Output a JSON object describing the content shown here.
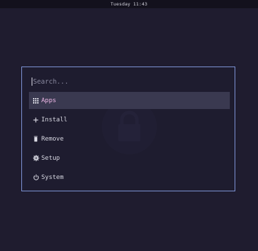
{
  "topbar": {
    "clock": "Tuesday 11:43"
  },
  "launcher": {
    "search": {
      "placeholder": "Search...",
      "value": ""
    },
    "items": [
      {
        "label": "Apps",
        "icon": "grid-icon",
        "selected": true
      },
      {
        "label": "Install",
        "icon": "plus-icon",
        "selected": false
      },
      {
        "label": "Remove",
        "icon": "trash-icon",
        "selected": false
      },
      {
        "label": "Setup",
        "icon": "gear-icon",
        "selected": false
      },
      {
        "label": "System",
        "icon": "power-icon",
        "selected": false
      }
    ]
  },
  "colors": {
    "background": "#1f1c2f",
    "border": "#7f95d8",
    "selected_bg": "#3a3950",
    "selected_text": "#f0b8e8"
  }
}
